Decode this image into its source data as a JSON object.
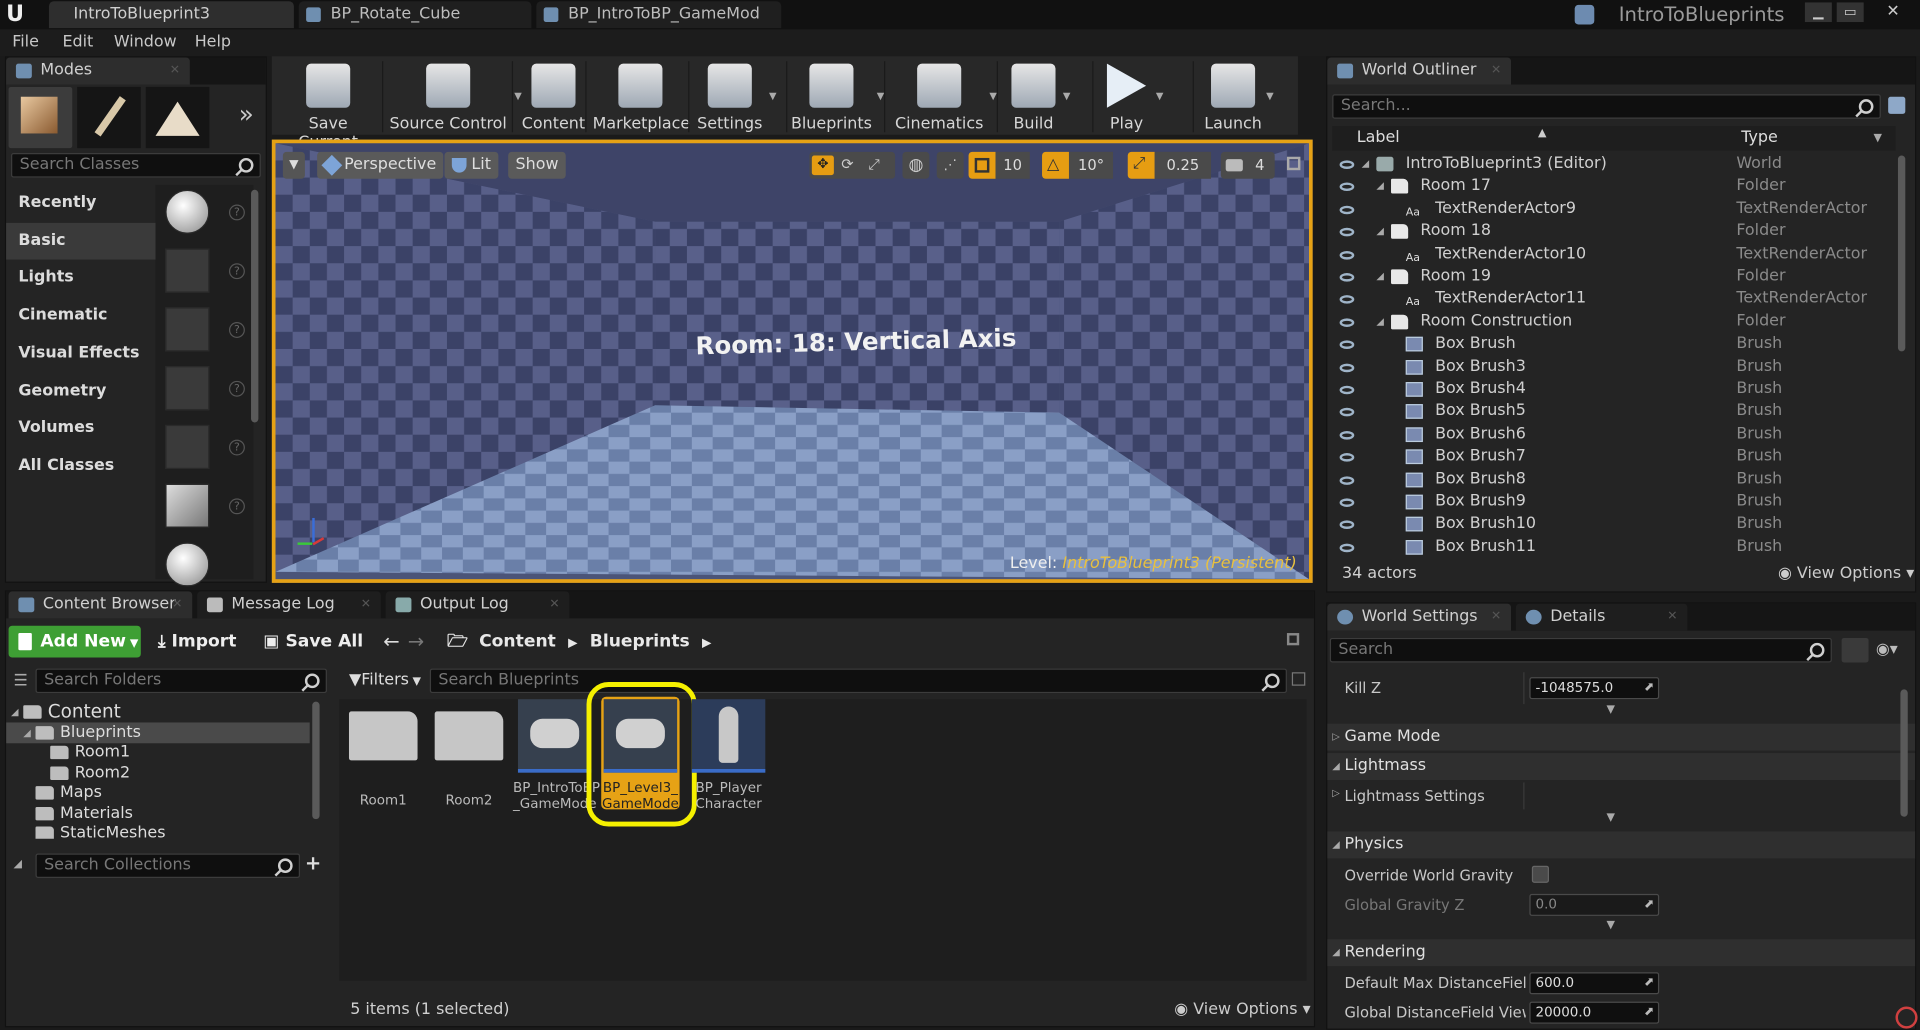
{
  "title_bar": {
    "tabs": [
      "IntroToBlueprint3",
      "BP_Rotate_Cube",
      "BP_IntroToBP_GameMod"
    ],
    "app_title": "IntroToBlueprints"
  },
  "menu": [
    "File",
    "Edit",
    "Window",
    "Help"
  ],
  "modes": {
    "tab": "Modes",
    "search_placeholder": "Search Classes",
    "categories": [
      "Recently Placed",
      "Basic",
      "Lights",
      "Cinematic",
      "Visual Effects",
      "Geometry",
      "Volumes",
      "All Classes"
    ],
    "selected_category": "Basic"
  },
  "toolbar": {
    "buttons": [
      "Save Current",
      "Source Control",
      "Content",
      "Marketplace",
      "Settings",
      "Blueprints",
      "Cinematics",
      "Build",
      "Play",
      "Launch"
    ]
  },
  "viewport": {
    "perspective": "Perspective",
    "lit": "Lit",
    "show": "Show",
    "grid_snap": "10",
    "rot_snap": "10°",
    "scale_snap": "0.25",
    "cam_speed": "4",
    "scene_text": "Room: 18: Vertical Axis",
    "level_label": "Level:",
    "level_name": "IntroToBlueprint3 (Persistent)"
  },
  "outliner": {
    "tab": "World Outliner",
    "search_placeholder": "Search...",
    "col_label": "Label",
    "col_type": "Type",
    "rows": [
      {
        "label": "IntroToBlueprint3 (Editor)",
        "type": "World",
        "indent": 0
      },
      {
        "label": "Room 17",
        "type": "Folder",
        "indent": 1
      },
      {
        "label": "TextRenderActor9",
        "type": "TextRenderActor",
        "indent": 2
      },
      {
        "label": "Room 18",
        "type": "Folder",
        "indent": 1
      },
      {
        "label": "TextRenderActor10",
        "type": "TextRenderActor",
        "indent": 2
      },
      {
        "label": "Room 19",
        "type": "Folder",
        "indent": 1
      },
      {
        "label": "TextRenderActor11",
        "type": "TextRenderActor",
        "indent": 2
      },
      {
        "label": "Room Construction",
        "type": "Folder",
        "indent": 1
      },
      {
        "label": "Box Brush",
        "type": "Brush",
        "indent": 2
      },
      {
        "label": "Box Brush3",
        "type": "Brush",
        "indent": 2
      },
      {
        "label": "Box Brush4",
        "type": "Brush",
        "indent": 2
      },
      {
        "label": "Box Brush5",
        "type": "Brush",
        "indent": 2
      },
      {
        "label": "Box Brush6",
        "type": "Brush",
        "indent": 2
      },
      {
        "label": "Box Brush7",
        "type": "Brush",
        "indent": 2
      },
      {
        "label": "Box Brush8",
        "type": "Brush",
        "indent": 2
      },
      {
        "label": "Box Brush9",
        "type": "Brush",
        "indent": 2
      },
      {
        "label": "Box Brush10",
        "type": "Brush",
        "indent": 2
      },
      {
        "label": "Box Brush11",
        "type": "Brush",
        "indent": 2
      }
    ],
    "actor_count": "34 actors",
    "view_options": "View Options"
  },
  "details": {
    "tab_world": "World Settings",
    "tab_details": "Details",
    "search_placeholder": "Search",
    "kill_z_label": "Kill Z",
    "kill_z_value": "-1048575.0",
    "game_mode": "Game Mode",
    "lightmass": "Lightmass",
    "lightmass_settings": "Lightmass Settings",
    "physics": "Physics",
    "override_gravity": "Override World Gravity",
    "gravity_z_label": "Global Gravity Z",
    "gravity_z_value": "0.0",
    "rendering": "Rendering",
    "max_df_label": "Default Max DistanceField (",
    "max_df_value": "600.0",
    "df_view_label": "Global DistanceField View D",
    "df_view_value": "20000.0"
  },
  "content_browser": {
    "tabs": [
      "Content Browser",
      "Message Log",
      "Output Log"
    ],
    "add_new": "Add New",
    "import": "Import",
    "save_all": "Save All",
    "breadcrumb": [
      "Content",
      "Blueprints"
    ],
    "search_folders": "Search Folders",
    "filters": "Filters",
    "search_blueprints": "Search Blueprints",
    "tree": [
      "Content",
      "Blueprints",
      "Room1",
      "Room2",
      "Maps",
      "Materials",
      "StaticMeshes"
    ],
    "search_collections": "Search Collections",
    "assets": [
      "Room1",
      "Room2",
      "BP_IntroToBP_GameMode",
      "BP_Level3_GameMode",
      "BP_Player Character"
    ],
    "asset_lines": [
      [
        "Room1"
      ],
      [
        "Room2"
      ],
      [
        "BP_IntroToBP",
        "_GameMode"
      ],
      [
        "BP_Level3_",
        "GameMode"
      ],
      [
        "BP_Player",
        "Character"
      ]
    ],
    "status": "5 items (1 selected)",
    "view_options": "View Options"
  }
}
